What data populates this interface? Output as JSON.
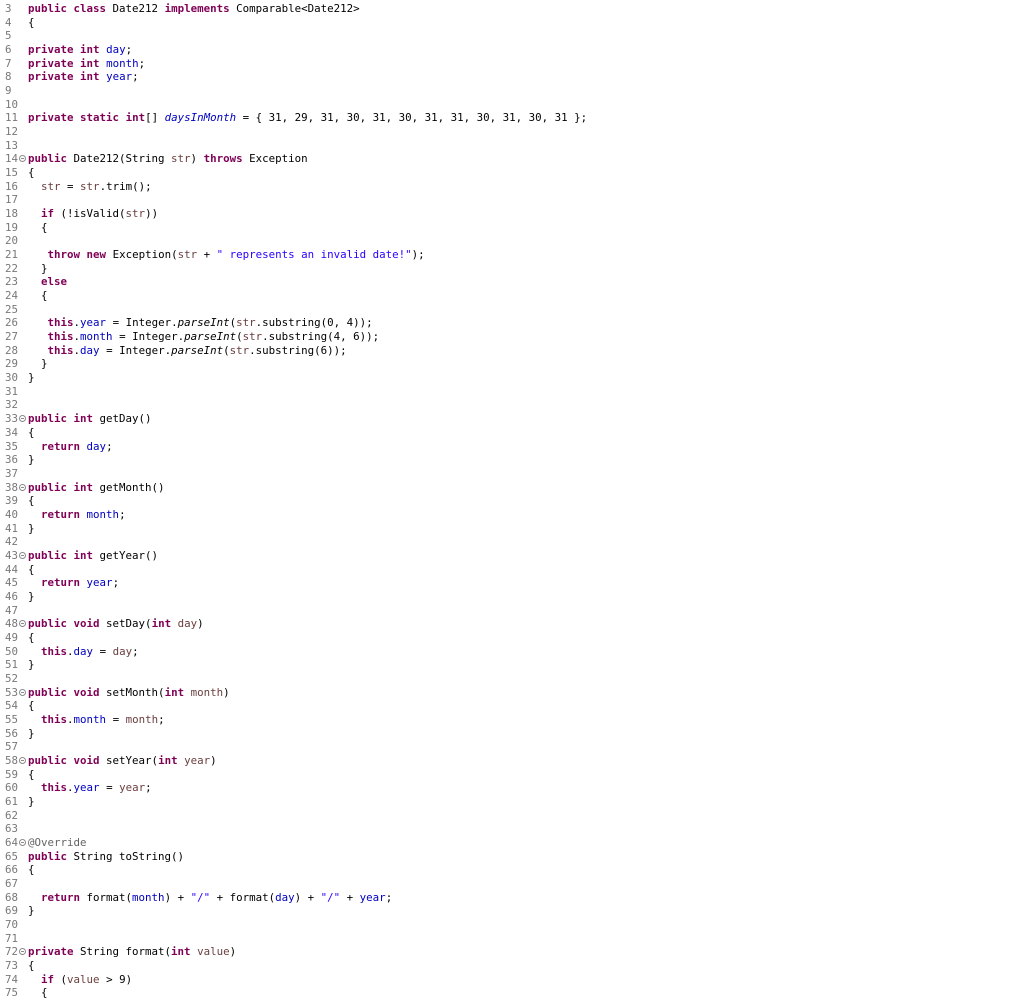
{
  "editor": {
    "lines": [
      {
        "n": "3",
        "fold": false,
        "t": [
          [
            "kw",
            "public"
          ],
          [
            "p",
            " "
          ],
          [
            "kw",
            "class"
          ],
          [
            "p",
            " Date212 "
          ],
          [
            "kw",
            "implements"
          ],
          [
            "p",
            " Comparable<Date212>"
          ]
        ]
      },
      {
        "n": "4",
        "fold": false,
        "t": [
          [
            "p",
            "{"
          ]
        ]
      },
      {
        "n": "5",
        "fold": false,
        "t": []
      },
      {
        "n": "6",
        "fold": false,
        "t": [
          [
            "kw",
            "private"
          ],
          [
            "p",
            " "
          ],
          [
            "kw",
            "int"
          ],
          [
            "p",
            " "
          ],
          [
            "fld",
            "day"
          ],
          [
            "p",
            ";"
          ]
        ]
      },
      {
        "n": "7",
        "fold": false,
        "t": [
          [
            "kw",
            "private"
          ],
          [
            "p",
            " "
          ],
          [
            "kw",
            "int"
          ],
          [
            "p",
            " "
          ],
          [
            "fld",
            "month"
          ],
          [
            "p",
            ";"
          ]
        ]
      },
      {
        "n": "8",
        "fold": false,
        "t": [
          [
            "kw",
            "private"
          ],
          [
            "p",
            " "
          ],
          [
            "kw",
            "int"
          ],
          [
            "p",
            " "
          ],
          [
            "fld",
            "year"
          ],
          [
            "p",
            ";"
          ]
        ]
      },
      {
        "n": "9",
        "fold": false,
        "t": []
      },
      {
        "n": "10",
        "fold": false,
        "t": []
      },
      {
        "n": "11",
        "fold": false,
        "t": [
          [
            "kw",
            "private"
          ],
          [
            "p",
            " "
          ],
          [
            "kw",
            "static"
          ],
          [
            "p",
            " "
          ],
          [
            "kw",
            "int"
          ],
          [
            "p",
            "[] "
          ],
          [
            "sfld",
            "daysInMonth"
          ],
          [
            "p",
            " = { 31, 29, 31, 30, 31, 30, 31, 31, 30, 31, 30, 31 };"
          ]
        ]
      },
      {
        "n": "12",
        "fold": false,
        "t": []
      },
      {
        "n": "13",
        "fold": false,
        "t": []
      },
      {
        "n": "14",
        "fold": true,
        "t": [
          [
            "kw",
            "public"
          ],
          [
            "p",
            " Date212(String "
          ],
          [
            "var",
            "str"
          ],
          [
            "p",
            ") "
          ],
          [
            "kw",
            "throws"
          ],
          [
            "p",
            " Exception"
          ]
        ]
      },
      {
        "n": "15",
        "fold": false,
        "t": [
          [
            "p",
            "{"
          ]
        ]
      },
      {
        "n": "16",
        "fold": false,
        "t": [
          [
            "p",
            "  "
          ],
          [
            "var",
            "str"
          ],
          [
            "p",
            " = "
          ],
          [
            "var",
            "str"
          ],
          [
            "p",
            ".trim();"
          ]
        ]
      },
      {
        "n": "17",
        "fold": false,
        "t": []
      },
      {
        "n": "18",
        "fold": false,
        "t": [
          [
            "p",
            "  "
          ],
          [
            "kw",
            "if"
          ],
          [
            "p",
            " (!isValid("
          ],
          [
            "var",
            "str"
          ],
          [
            "p",
            "))"
          ]
        ]
      },
      {
        "n": "19",
        "fold": false,
        "t": [
          [
            "p",
            "  {"
          ]
        ]
      },
      {
        "n": "20",
        "fold": false,
        "t": []
      },
      {
        "n": "21",
        "fold": false,
        "t": [
          [
            "p",
            "   "
          ],
          [
            "kw",
            "throw"
          ],
          [
            "p",
            " "
          ],
          [
            "kw",
            "new"
          ],
          [
            "p",
            " Exception("
          ],
          [
            "var",
            "str"
          ],
          [
            "p",
            " + "
          ],
          [
            "str",
            "\" represents an invalid date!\""
          ],
          [
            "p",
            ");"
          ]
        ]
      },
      {
        "n": "22",
        "fold": false,
        "t": [
          [
            "p",
            "  }"
          ]
        ]
      },
      {
        "n": "23",
        "fold": false,
        "t": [
          [
            "p",
            "  "
          ],
          [
            "kw",
            "else"
          ]
        ]
      },
      {
        "n": "24",
        "fold": false,
        "t": [
          [
            "p",
            "  {"
          ]
        ]
      },
      {
        "n": "25",
        "fold": false,
        "t": []
      },
      {
        "n": "26",
        "fold": false,
        "t": [
          [
            "p",
            "   "
          ],
          [
            "kw",
            "this"
          ],
          [
            "p",
            "."
          ],
          [
            "fld",
            "year"
          ],
          [
            "p",
            " = Integer."
          ],
          [
            "smeth",
            "parseInt"
          ],
          [
            "p",
            "("
          ],
          [
            "var",
            "str"
          ],
          [
            "p",
            ".substring(0, 4));"
          ]
        ]
      },
      {
        "n": "27",
        "fold": false,
        "t": [
          [
            "p",
            "   "
          ],
          [
            "kw",
            "this"
          ],
          [
            "p",
            "."
          ],
          [
            "fld",
            "month"
          ],
          [
            "p",
            " = Integer."
          ],
          [
            "smeth",
            "parseInt"
          ],
          [
            "p",
            "("
          ],
          [
            "var",
            "str"
          ],
          [
            "p",
            ".substring(4, 6));"
          ]
        ]
      },
      {
        "n": "28",
        "fold": false,
        "t": [
          [
            "p",
            "   "
          ],
          [
            "kw",
            "this"
          ],
          [
            "p",
            "."
          ],
          [
            "fld",
            "day"
          ],
          [
            "p",
            " = Integer."
          ],
          [
            "smeth",
            "parseInt"
          ],
          [
            "p",
            "("
          ],
          [
            "var",
            "str"
          ],
          [
            "p",
            ".substring(6));"
          ]
        ]
      },
      {
        "n": "29",
        "fold": false,
        "t": [
          [
            "p",
            "  }"
          ]
        ]
      },
      {
        "n": "30",
        "fold": false,
        "t": [
          [
            "p",
            "}"
          ]
        ]
      },
      {
        "n": "31",
        "fold": false,
        "t": []
      },
      {
        "n": "32",
        "fold": false,
        "t": []
      },
      {
        "n": "33",
        "fold": true,
        "t": [
          [
            "kw",
            "public"
          ],
          [
            "p",
            " "
          ],
          [
            "kw",
            "int"
          ],
          [
            "p",
            " getDay()"
          ]
        ]
      },
      {
        "n": "34",
        "fold": false,
        "t": [
          [
            "p",
            "{"
          ]
        ]
      },
      {
        "n": "35",
        "fold": false,
        "t": [
          [
            "p",
            "  "
          ],
          [
            "kw",
            "return"
          ],
          [
            "p",
            " "
          ],
          [
            "fld",
            "day"
          ],
          [
            "p",
            ";"
          ]
        ]
      },
      {
        "n": "36",
        "fold": false,
        "t": [
          [
            "p",
            "}"
          ]
        ]
      },
      {
        "n": "37",
        "fold": false,
        "t": []
      },
      {
        "n": "38",
        "fold": true,
        "t": [
          [
            "kw",
            "public"
          ],
          [
            "p",
            " "
          ],
          [
            "kw",
            "int"
          ],
          [
            "p",
            " getMonth()"
          ]
        ]
      },
      {
        "n": "39",
        "fold": false,
        "t": [
          [
            "p",
            "{"
          ]
        ]
      },
      {
        "n": "40",
        "fold": false,
        "t": [
          [
            "p",
            "  "
          ],
          [
            "kw",
            "return"
          ],
          [
            "p",
            " "
          ],
          [
            "fld",
            "month"
          ],
          [
            "p",
            ";"
          ]
        ]
      },
      {
        "n": "41",
        "fold": false,
        "t": [
          [
            "p",
            "}"
          ]
        ]
      },
      {
        "n": "42",
        "fold": false,
        "t": []
      },
      {
        "n": "43",
        "fold": true,
        "t": [
          [
            "kw",
            "public"
          ],
          [
            "p",
            " "
          ],
          [
            "kw",
            "int"
          ],
          [
            "p",
            " getYear()"
          ]
        ]
      },
      {
        "n": "44",
        "fold": false,
        "t": [
          [
            "p",
            "{"
          ]
        ]
      },
      {
        "n": "45",
        "fold": false,
        "t": [
          [
            "p",
            "  "
          ],
          [
            "kw",
            "return"
          ],
          [
            "p",
            " "
          ],
          [
            "fld",
            "year"
          ],
          [
            "p",
            ";"
          ]
        ]
      },
      {
        "n": "46",
        "fold": false,
        "t": [
          [
            "p",
            "}"
          ]
        ]
      },
      {
        "n": "47",
        "fold": false,
        "t": []
      },
      {
        "n": "48",
        "fold": true,
        "t": [
          [
            "kw",
            "public"
          ],
          [
            "p",
            " "
          ],
          [
            "kw",
            "void"
          ],
          [
            "p",
            " setDay("
          ],
          [
            "kw",
            "int"
          ],
          [
            "p",
            " "
          ],
          [
            "var",
            "day"
          ],
          [
            "p",
            ")"
          ]
        ]
      },
      {
        "n": "49",
        "fold": false,
        "t": [
          [
            "p",
            "{"
          ]
        ]
      },
      {
        "n": "50",
        "fold": false,
        "t": [
          [
            "p",
            "  "
          ],
          [
            "kw",
            "this"
          ],
          [
            "p",
            "."
          ],
          [
            "fld",
            "day"
          ],
          [
            "p",
            " = "
          ],
          [
            "var",
            "day"
          ],
          [
            "p",
            ";"
          ]
        ]
      },
      {
        "n": "51",
        "fold": false,
        "t": [
          [
            "p",
            "}"
          ]
        ]
      },
      {
        "n": "52",
        "fold": false,
        "t": []
      },
      {
        "n": "53",
        "fold": true,
        "t": [
          [
            "kw",
            "public"
          ],
          [
            "p",
            " "
          ],
          [
            "kw",
            "void"
          ],
          [
            "p",
            " setMonth("
          ],
          [
            "kw",
            "int"
          ],
          [
            "p",
            " "
          ],
          [
            "var",
            "month"
          ],
          [
            "p",
            ")"
          ]
        ]
      },
      {
        "n": "54",
        "fold": false,
        "t": [
          [
            "p",
            "{"
          ]
        ]
      },
      {
        "n": "55",
        "fold": false,
        "t": [
          [
            "p",
            "  "
          ],
          [
            "kw",
            "this"
          ],
          [
            "p",
            "."
          ],
          [
            "fld",
            "month"
          ],
          [
            "p",
            " = "
          ],
          [
            "var",
            "month"
          ],
          [
            "p",
            ";"
          ]
        ]
      },
      {
        "n": "56",
        "fold": false,
        "t": [
          [
            "p",
            "}"
          ]
        ]
      },
      {
        "n": "57",
        "fold": false,
        "t": []
      },
      {
        "n": "58",
        "fold": true,
        "t": [
          [
            "kw",
            "public"
          ],
          [
            "p",
            " "
          ],
          [
            "kw",
            "void"
          ],
          [
            "p",
            " setYear("
          ],
          [
            "kw",
            "int"
          ],
          [
            "p",
            " "
          ],
          [
            "var",
            "year"
          ],
          [
            "p",
            ")"
          ]
        ]
      },
      {
        "n": "59",
        "fold": false,
        "t": [
          [
            "p",
            "{"
          ]
        ]
      },
      {
        "n": "60",
        "fold": false,
        "t": [
          [
            "p",
            "  "
          ],
          [
            "kw",
            "this"
          ],
          [
            "p",
            "."
          ],
          [
            "fld",
            "year"
          ],
          [
            "p",
            " = "
          ],
          [
            "var",
            "year"
          ],
          [
            "p",
            ";"
          ]
        ]
      },
      {
        "n": "61",
        "fold": false,
        "t": [
          [
            "p",
            "}"
          ]
        ]
      },
      {
        "n": "62",
        "fold": false,
        "t": []
      },
      {
        "n": "63",
        "fold": false,
        "t": []
      },
      {
        "n": "64",
        "fold": true,
        "t": [
          [
            "ann",
            "@Override"
          ]
        ]
      },
      {
        "n": "65",
        "fold": false,
        "t": [
          [
            "kw",
            "public"
          ],
          [
            "p",
            " String toString()"
          ]
        ]
      },
      {
        "n": "66",
        "fold": false,
        "t": [
          [
            "p",
            "{"
          ]
        ]
      },
      {
        "n": "67",
        "fold": false,
        "t": []
      },
      {
        "n": "68",
        "fold": false,
        "t": [
          [
            "p",
            "  "
          ],
          [
            "kw",
            "return"
          ],
          [
            "p",
            " format("
          ],
          [
            "fld",
            "month"
          ],
          [
            "p",
            ") + "
          ],
          [
            "str",
            "\"/\""
          ],
          [
            "p",
            " + format("
          ],
          [
            "fld",
            "day"
          ],
          [
            "p",
            ") + "
          ],
          [
            "str",
            "\"/\""
          ],
          [
            "p",
            " + "
          ],
          [
            "fld",
            "year"
          ],
          [
            "p",
            ";"
          ]
        ]
      },
      {
        "n": "69",
        "fold": false,
        "t": [
          [
            "p",
            "}"
          ]
        ]
      },
      {
        "n": "70",
        "fold": false,
        "t": []
      },
      {
        "n": "71",
        "fold": false,
        "t": []
      },
      {
        "n": "72",
        "fold": true,
        "t": [
          [
            "kw",
            "private"
          ],
          [
            "p",
            " String format("
          ],
          [
            "kw",
            "int"
          ],
          [
            "p",
            " "
          ],
          [
            "var",
            "value"
          ],
          [
            "p",
            ")"
          ]
        ]
      },
      {
        "n": "73",
        "fold": false,
        "t": [
          [
            "p",
            "{"
          ]
        ]
      },
      {
        "n": "74",
        "fold": false,
        "t": [
          [
            "p",
            "  "
          ],
          [
            "kw",
            "if"
          ],
          [
            "p",
            " ("
          ],
          [
            "var",
            "value"
          ],
          [
            "p",
            " > 9)"
          ]
        ]
      },
      {
        "n": "75",
        "fold": false,
        "t": [
          [
            "p",
            "  {"
          ]
        ]
      }
    ]
  }
}
